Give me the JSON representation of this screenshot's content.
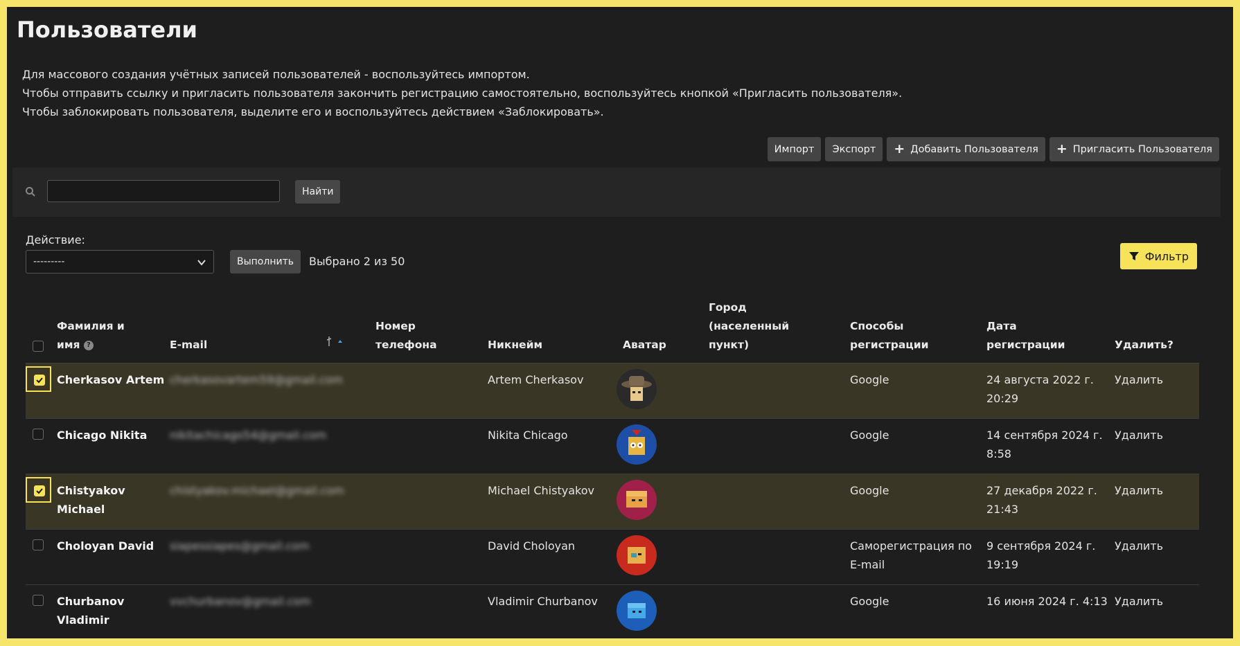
{
  "page": {
    "title": "Пользователи"
  },
  "intro": [
    "Для массового создания учётных записей пользователей - воспользуйтесь импортом.",
    "Чтобы отправить ссылку и пригласить пользователя закончить регистрацию самостоятельно, воспользуйтесь кнопкой «Пригласить пользователя».",
    "Чтобы заблокировать пользователя, выделите его и воспользуйтесь действием «Заблокировать»."
  ],
  "toolbar": {
    "import_label": "Импорт",
    "export_label": "Экспорт",
    "add_user_label": "Добавить Пользователя",
    "invite_user_label": "Пригласить Пользователя"
  },
  "search": {
    "value": "",
    "button_label": "Найти"
  },
  "actions": {
    "label": "Действие:",
    "selected_value": "---------",
    "run_label": "Выполнить",
    "selected_count_text": "Выбрано 2 из 50",
    "filter_label": "Фильтр"
  },
  "columns": {
    "name_line1": "Фамилия и",
    "name_line2": "имя",
    "email": "E-mail",
    "phone_line1": "Номер",
    "phone_line2": "телефона",
    "nickname": "Никнейм",
    "avatar": "Аватар",
    "city_line1": "Город",
    "city_line2": "(населенный",
    "city_line3": "пункт)",
    "reg_methods_line1": "Способы",
    "reg_methods_line2": "регистрации",
    "reg_date_line1": "Дата",
    "reg_date_line2": "регистрации",
    "delete": "Удалить?"
  },
  "rows": [
    {
      "selected": true,
      "name_line1": "Cherkasov Artem",
      "name_line2": "",
      "email": "cherkasovartem59@gmail.com",
      "phone": "",
      "nickname": "Artem Cherkasov",
      "city": "",
      "reg_method_line1": "Google",
      "reg_method_line2": "",
      "date_line1": "24 августа 2022 г.",
      "date_line2": "20:29",
      "delete_label": "Удалить",
      "avatar_color": "#2a2a2a"
    },
    {
      "selected": false,
      "name_line1": "Chicago Nikita",
      "name_line2": "",
      "email": "nikitachicago54@gmail.com",
      "phone": "",
      "nickname": "Nikita Chicago",
      "city": "",
      "reg_method_line1": "Google",
      "reg_method_line2": "",
      "date_line1": "14 сентября 2024 г.",
      "date_line2": "8:58",
      "delete_label": "Удалить",
      "avatar_color": "#1d4fa6"
    },
    {
      "selected": true,
      "name_line1": "Chistyakov",
      "name_line2": "Michael",
      "email": "chistyakov.michael@gmail.com",
      "phone": "",
      "nickname": "Michael Chistyakov",
      "city": "",
      "reg_method_line1": "Google",
      "reg_method_line2": "",
      "date_line1": "27 декабря 2022 г.",
      "date_line2": "21:43",
      "delete_label": "Удалить",
      "avatar_color": "#a0204a"
    },
    {
      "selected": false,
      "name_line1": "Choloyan David",
      "name_line2": "",
      "email": "siapessiapes@gmail.com",
      "phone": "",
      "nickname": "David Choloyan",
      "city": "",
      "reg_method_line1": "Саморегистрация по",
      "reg_method_line2": "E-mail",
      "date_line1": "9 сентября 2024 г.",
      "date_line2": "19:19",
      "delete_label": "Удалить",
      "avatar_color": "#c92a1e"
    },
    {
      "selected": false,
      "name_line1": "Churbanov",
      "name_line2": "Vladimir",
      "email": "vvchurbanov@gmail.com",
      "phone": "",
      "nickname": "Vladimir Churbanov",
      "city": "",
      "reg_method_line1": "Google",
      "reg_method_line2": "",
      "date_line1": "16 июня 2024 г. 4:13",
      "date_line2": "",
      "delete_label": "Удалить",
      "avatar_color": "#1d5fb8"
    }
  ],
  "colors": {
    "accent": "#f7e35a",
    "background": "#1e1e1e",
    "selected_row": "#3a3626"
  }
}
